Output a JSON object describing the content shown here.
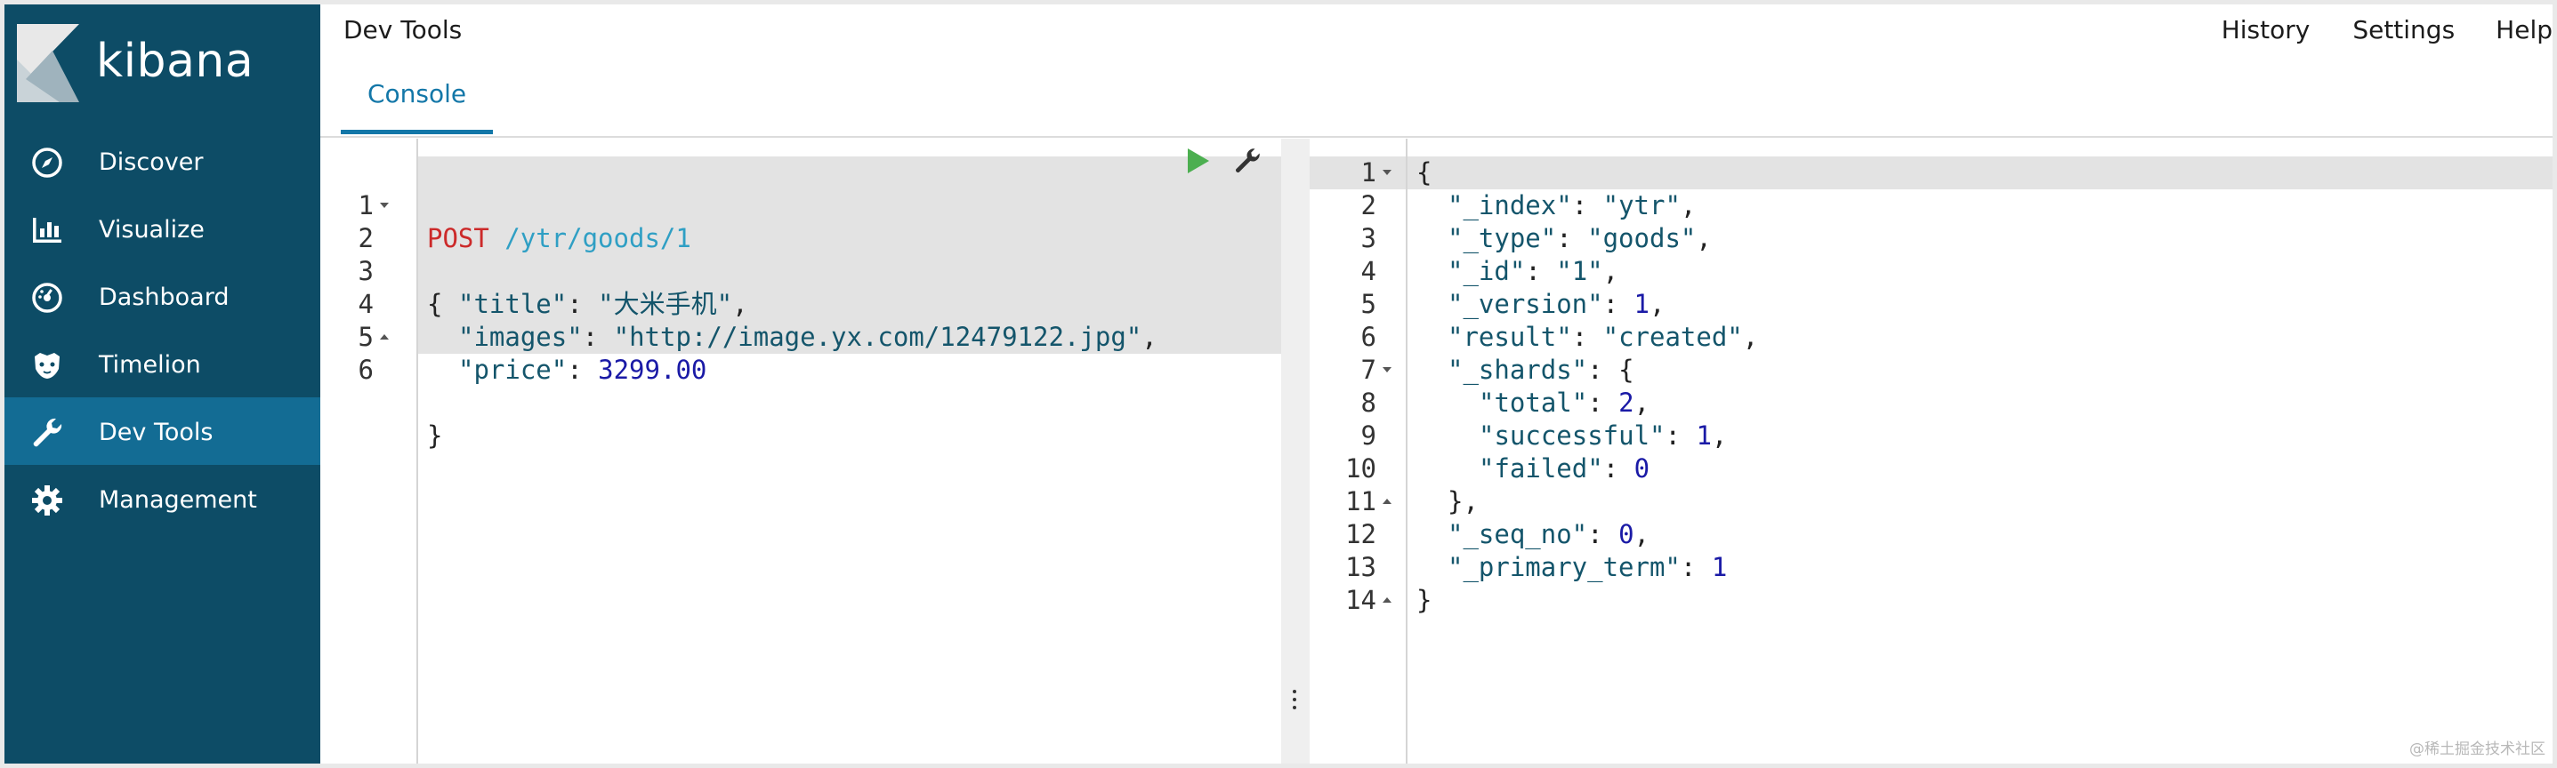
{
  "sidebar": {
    "brand": "kibana",
    "items": [
      {
        "label": "Discover",
        "icon": "compass-icon"
      },
      {
        "label": "Visualize",
        "icon": "bar-chart-icon"
      },
      {
        "label": "Dashboard",
        "icon": "dashboard-icon"
      },
      {
        "label": "Timelion",
        "icon": "timelion-icon"
      },
      {
        "label": "Dev Tools",
        "icon": "wrench-icon",
        "active": true
      },
      {
        "label": "Management",
        "icon": "gear-icon"
      }
    ]
  },
  "header": {
    "title": "Dev Tools",
    "links": [
      "History",
      "Settings",
      "Help"
    ],
    "tab": "Console"
  },
  "request_editor": {
    "line_numbers": [
      "1",
      "2",
      "3",
      "4",
      "5",
      "6"
    ],
    "lines": [
      {
        "method": "POST",
        "url": " /ytr/goods/1"
      },
      {
        "text": "{"
      },
      {
        "key": "\"title\"",
        "sep": ": ",
        "value": "\"大米手机\"",
        "tail": ","
      },
      {
        "key": "\"images\"",
        "sep": ": ",
        "value": "\"http://image.yx.com/12479122.jpg\"",
        "tail": ","
      },
      {
        "key": "\"price\"",
        "sep": ": ",
        "num": "3299.00",
        "tail": ""
      },
      {
        "text": "}"
      }
    ]
  },
  "response_editor": {
    "line_numbers": [
      "1",
      "2",
      "3",
      "4",
      "5",
      "6",
      "7",
      "8",
      "9",
      "10",
      "11",
      "12",
      "13",
      "14"
    ],
    "lines": [
      {
        "text": "{"
      },
      {
        "key": "\"_index\"",
        "sep": ": ",
        "value": "\"ytr\"",
        "tail": ","
      },
      {
        "key": "\"_type\"",
        "sep": ": ",
        "value": "\"goods\"",
        "tail": ","
      },
      {
        "key": "\"_id\"",
        "sep": ": ",
        "value": "\"1\"",
        "tail": ","
      },
      {
        "key": "\"_version\"",
        "sep": ": ",
        "num": "1",
        "tail": ","
      },
      {
        "key": "\"result\"",
        "sep": ": ",
        "value": "\"created\"",
        "tail": ","
      },
      {
        "key": "\"_shards\"",
        "sep": ": ",
        "text2": "{",
        "tail": ""
      },
      {
        "key": "\"total\"",
        "sep": ": ",
        "num": "2",
        "tail": ","
      },
      {
        "key": "\"successful\"",
        "sep": ": ",
        "num": "1",
        "tail": ","
      },
      {
        "key": "\"failed\"",
        "sep": ": ",
        "num": "0",
        "tail": ""
      },
      {
        "text": "},"
      },
      {
        "key": "\"_seq_no\"",
        "sep": ": ",
        "num": "0",
        "tail": ","
      },
      {
        "key": "\"_primary_term\"",
        "sep": ": ",
        "num": "1",
        "tail": ""
      },
      {
        "text": "}"
      }
    ]
  },
  "watermark": "@稀土掘金技术社区",
  "colors": {
    "sidebar": "#0d4c66",
    "sidebar_active": "#136c94",
    "accent": "#1377a8",
    "run": "#4caf50"
  }
}
